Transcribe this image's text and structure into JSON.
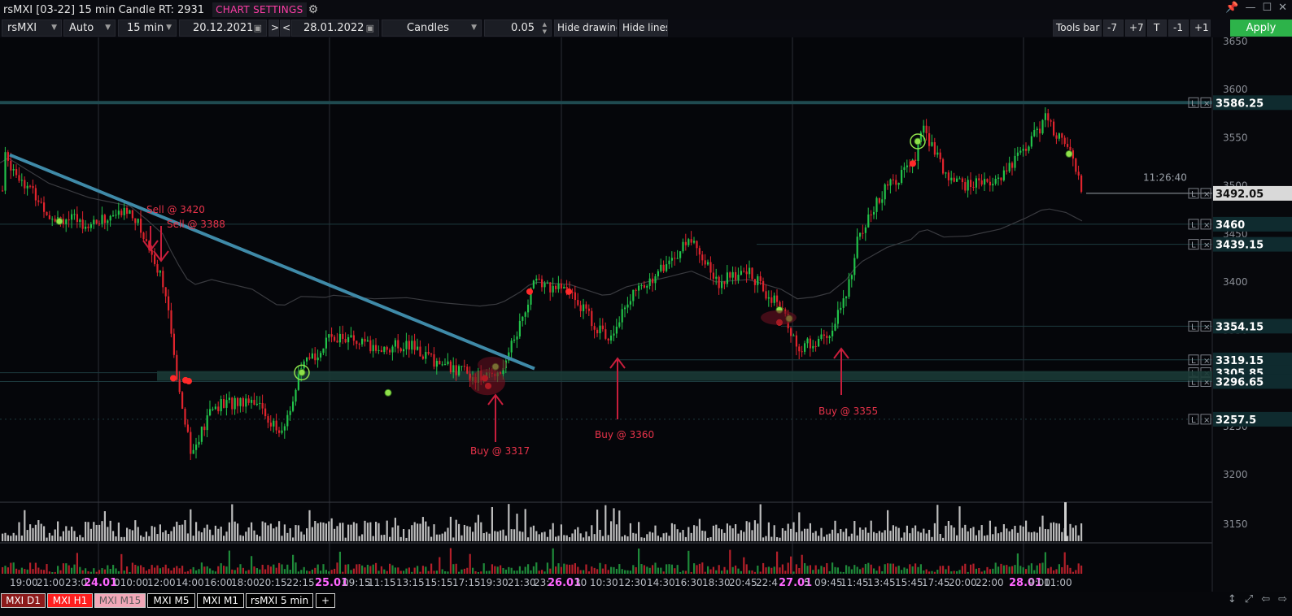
{
  "window": {
    "title": "rsMXI [03-22] 15 min Candle RT: 2931",
    "chart_settings_label": "CHART SETTINGS",
    "controls": [
      "pin-icon",
      "minimize-icon",
      "maximize-icon",
      "close-icon"
    ]
  },
  "toolbar": {
    "symbol": "rsMXI",
    "scale": "Auto",
    "timeframe": "15 min",
    "date_from": "20.12.2021",
    "next_label": ">",
    "prev_label": "<",
    "date_to": "28.01.2022",
    "chart_type": "Candles",
    "step": "0.05",
    "hide_drawing": "Hide drawing",
    "hide_lines": "Hide lines",
    "tools_bar": "Tools bar",
    "minus7": "-7",
    "plus7": "+7",
    "t": "T",
    "minus1": "-1",
    "plus1": "+1",
    "apply": "Apply",
    "colors": {
      "apply": "#2db34a"
    }
  },
  "chart_data": {
    "type": "candlestick",
    "ylim": [
      3170,
      3660
    ],
    "y_ticks": [
      3150,
      3200,
      3250,
      3300,
      3350,
      3400,
      3450,
      3500,
      3550,
      3600,
      3650
    ],
    "price_levels": [
      {
        "value": 3586.25,
        "label": "3586.25"
      },
      {
        "value": 3492.05,
        "label": "3492.05"
      },
      {
        "value": 3460,
        "label": "3460"
      },
      {
        "value": 3439.15,
        "label": "3439.15"
      },
      {
        "value": 3354.15,
        "label": "3354.15"
      },
      {
        "value": 3319.15,
        "label": "3319.15"
      },
      {
        "value": 3305.85,
        "label": "3305.85"
      },
      {
        "value": 3296.65,
        "label": "3296.65"
      },
      {
        "value": 3257.5,
        "label": "3257.5"
      }
    ],
    "current_time": "11:26:40",
    "x_tick_labels": [
      "19:00",
      "21:00",
      "23:0",
      "24.01",
      "010:00",
      "12:00",
      "14:00",
      "16:00",
      "18:00",
      "20:15",
      "22:15",
      "25.01",
      "09:15",
      "11:15",
      "13:15",
      "15:15",
      "17:15",
      "19:30",
      "21:30",
      "23:",
      "26.01",
      "30",
      "10:30",
      "12:30",
      "14:30",
      "16:30",
      "18:30",
      "20:45",
      "22:4",
      "27.01",
      "5",
      "09:45",
      "11:45",
      "13:45",
      "15:45",
      "17:45",
      "20:00",
      "22:00",
      "28.01",
      "9:00",
      "11:00"
    ],
    "date_labels": [
      "24.01",
      "25.01",
      "26.01",
      "27.01",
      "28.01"
    ],
    "annotations": [
      {
        "text": "Sell @ 3420",
        "kind": "sell"
      },
      {
        "text": "Sell @ 3388",
        "kind": "sell"
      },
      {
        "text": "Buy @ 3317",
        "kind": "buy"
      },
      {
        "text": "Buy @ 3360",
        "kind": "buy"
      },
      {
        "text": "Buy @ 3355",
        "kind": "buy"
      }
    ],
    "colors": {
      "up": "#22c24a",
      "down": "#e0242d",
      "trendline": "#3f8aa8",
      "annotation": "#e8334a",
      "date_label": "#ff66ff"
    }
  },
  "tabs": [
    {
      "label": "MXI D1",
      "bg": "#8b1a1a"
    },
    {
      "label": "MXI H1",
      "bg": "#ff1f1f"
    },
    {
      "label": "MXI M15",
      "bg": "#f2a8b8",
      "text": "#5a5a5a"
    },
    {
      "label": "MXI M5",
      "bg": "#000000"
    },
    {
      "label": "MXI M1",
      "bg": "#000000"
    },
    {
      "label": "rsMXI 5 min",
      "bg": "#000000"
    },
    {
      "label": "+",
      "bg": "#000000"
    }
  ]
}
